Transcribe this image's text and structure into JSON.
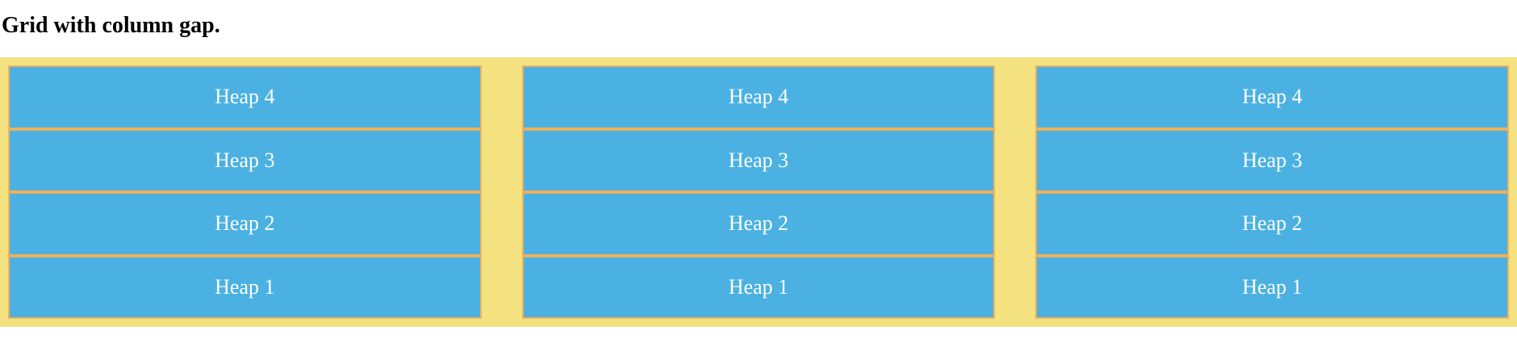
{
  "page": {
    "title": "Grid with column gap."
  },
  "grid": {
    "columns": [
      {
        "cells": [
          "Heap 4",
          "Heap 3",
          "Heap 2",
          "Heap 1"
        ]
      },
      {
        "cells": [
          "Heap 4",
          "Heap 3",
          "Heap 2",
          "Heap 1"
        ]
      },
      {
        "cells": [
          "Heap 4",
          "Heap 3",
          "Heap 2",
          "Heap 1"
        ]
      }
    ]
  },
  "colors": {
    "container_background": "#f3e27f",
    "cell_background": "#4bb1e2",
    "cell_border": "#f0b05b",
    "cell_text": "#ffffff"
  }
}
